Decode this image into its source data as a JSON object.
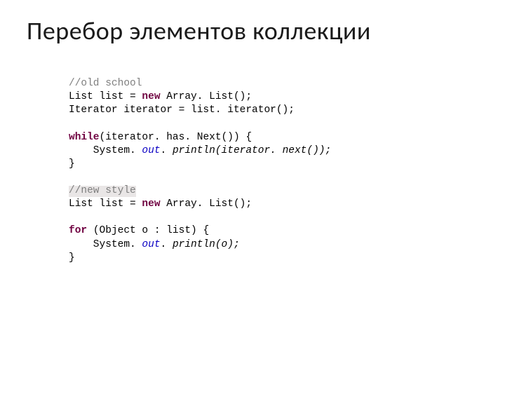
{
  "title": "Перебор элементов коллекции",
  "code": {
    "c1": "//old school",
    "l2a": "List list = ",
    "l2b": "new ",
    "l2c": "Array. List();",
    "l3": "Iterator iterator = list. iterator();",
    "l4a": "while",
    "l4b": "(iterator. has. Next()) {",
    "l5a": "    System. ",
    "l5b": "out",
    "l5c": ". ",
    "l5d": "println(iterator. next());",
    "l6": "}",
    "c2": "//new style",
    "l8a": "List list = ",
    "l8b": "new ",
    "l8c": "Array. List();",
    "l9a": "for ",
    "l9b": "(Object o : list) {",
    "l10a": "    System. ",
    "l10b": "out",
    "l10c": ". ",
    "l10d": "println(o);",
    "l11": "}"
  }
}
